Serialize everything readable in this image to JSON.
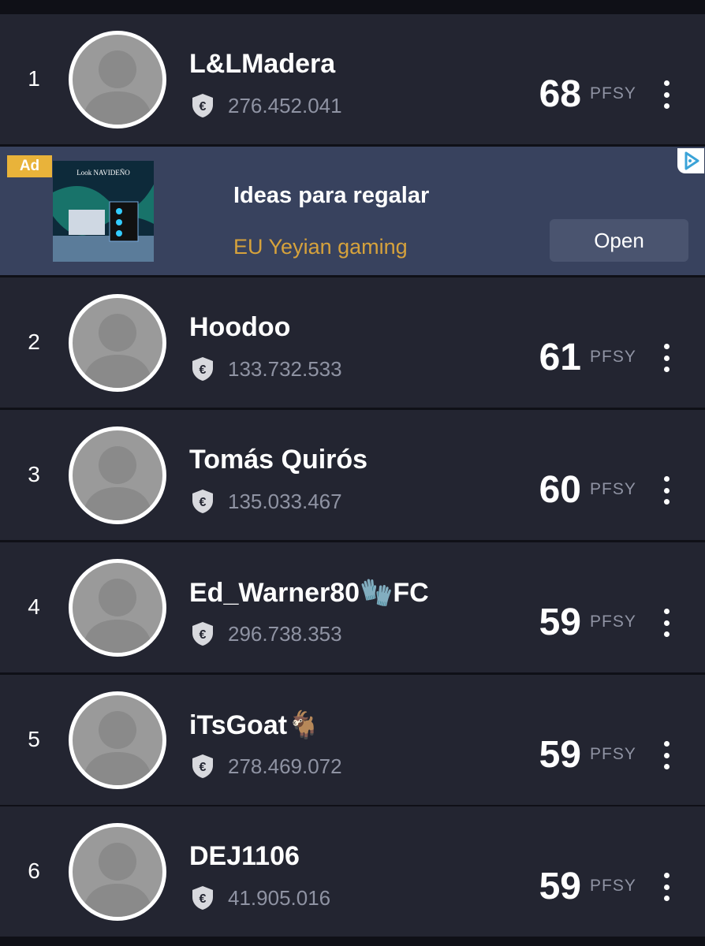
{
  "leaderboard": [
    {
      "rank": "1",
      "name": "L&LMadera",
      "money": "276.452.041",
      "points": "68",
      "unit": "PFSY"
    },
    {
      "rank": "2",
      "name": "Hoodoo",
      "money": "133.732.533",
      "points": "61",
      "unit": "PFSY"
    },
    {
      "rank": "3",
      "name": "Tomás Quirós",
      "money": "135.033.467",
      "points": "60",
      "unit": "PFSY"
    },
    {
      "rank": "4",
      "name": "Ed_Warner80🧤FC",
      "money": "296.738.353",
      "points": "59",
      "unit": "PFSY"
    },
    {
      "rank": "5",
      "name": "iTsGoat🐐",
      "money": "278.469.072",
      "points": "59",
      "unit": "PFSY"
    },
    {
      "rank": "6",
      "name": "DEJ1106",
      "money": "41.905.016",
      "points": "59",
      "unit": "PFSY"
    }
  ],
  "ad": {
    "badge": "Ad",
    "title": "Ideas para regalar",
    "advertiser": "EU Yeyian gaming",
    "cta": "Open",
    "thumb_text": "Look NAVIDEÑO"
  },
  "icons": {
    "avatar": "default-user-avatar-icon",
    "currency": "euro-shield-icon",
    "more": "vertical-ellipsis-icon",
    "adchoices": "adchoices-icon"
  },
  "colors": {
    "row_bg": "#232531",
    "page_bg": "#0f1017",
    "ad_bg": "#38425e",
    "ad_badge": "#e9b33a",
    "ad_advertiser": "#d6a23c",
    "muted_text": "#8f93a3"
  }
}
